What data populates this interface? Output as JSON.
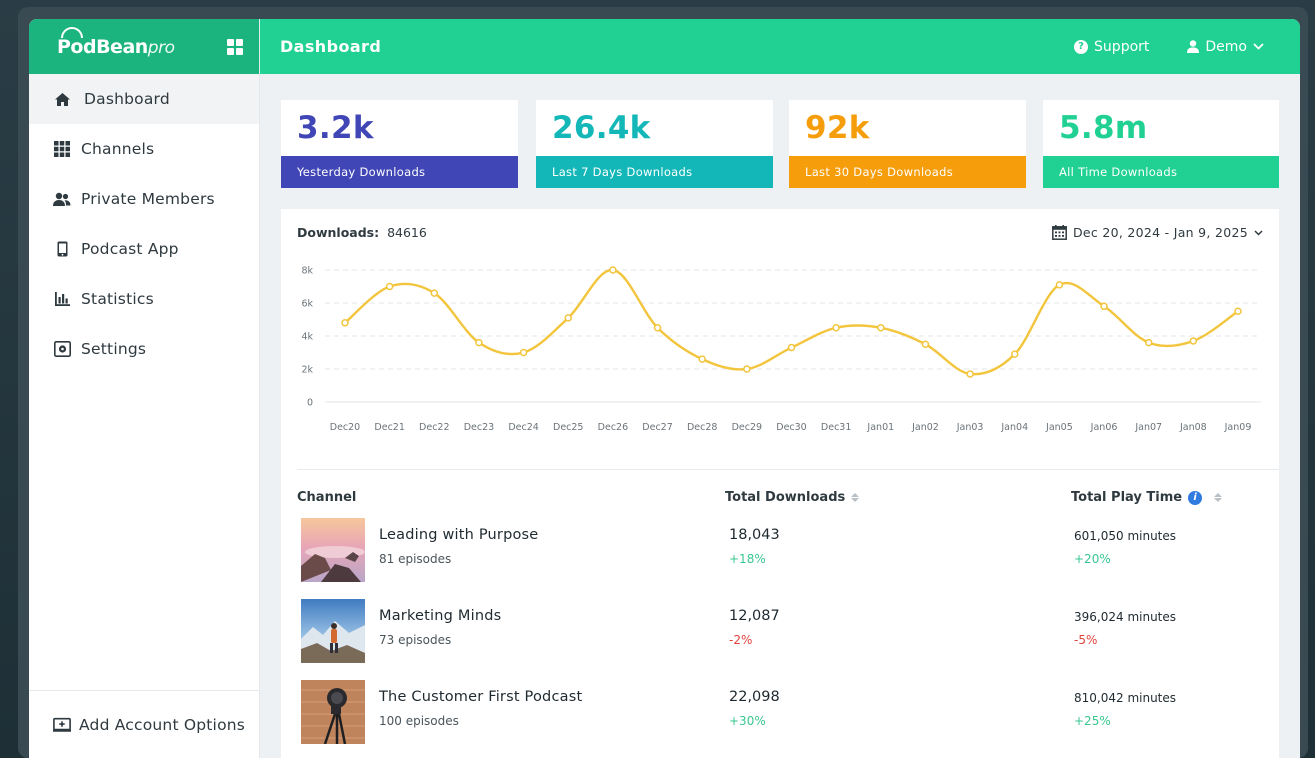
{
  "brand": {
    "logo_main": "PodBean",
    "logo_sub": "pro"
  },
  "topbar": {
    "title": "Dashboard",
    "support_label": "Support",
    "user_label": "Demo"
  },
  "sidebar": {
    "items": [
      {
        "label": "Dashboard",
        "icon": "home-icon",
        "active": true
      },
      {
        "label": "Channels",
        "icon": "grid-icon",
        "active": false
      },
      {
        "label": "Private Members",
        "icon": "users-icon",
        "active": false
      },
      {
        "label": "Podcast App",
        "icon": "phone-icon",
        "active": false
      },
      {
        "label": "Statistics",
        "icon": "bar-chart-icon",
        "active": false
      },
      {
        "label": "Settings",
        "icon": "gear-icon",
        "active": false
      }
    ],
    "bottom_label": "Add Account Options"
  },
  "stats": [
    {
      "value": "3.2k",
      "label": "Yesterday Downloads",
      "color": "#4046b5"
    },
    {
      "value": "26.4k",
      "label": "Last 7 Days Downloads",
      "color": "#14b7b7"
    },
    {
      "value": "92k",
      "label": "Last 30 Days Downloads",
      "color": "#f59d0b"
    },
    {
      "value": "5.8m",
      "label": "All Time Downloads",
      "color": "#21d193"
    }
  ],
  "chart_header": {
    "label": "Downloads",
    "total": "84616",
    "date_range": "Dec 20,  2024 - Jan 9,  2025"
  },
  "chart_data": {
    "type": "line",
    "title": "Downloads",
    "categories": [
      "Dec20",
      "Dec21",
      "Dec22",
      "Dec23",
      "Dec24",
      "Dec25",
      "Dec26",
      "Dec27",
      "Dec28",
      "Dec29",
      "Dec30",
      "Dec31",
      "Jan01",
      "Jan02",
      "Jan03",
      "Jan04",
      "Jan05",
      "Jan06",
      "Jan07",
      "Jan08",
      "Jan09"
    ],
    "values": [
      4800,
      7000,
      6600,
      3600,
      3000,
      5100,
      8000,
      4500,
      2600,
      2000,
      3300,
      4500,
      4500,
      3500,
      1700,
      2900,
      7100,
      5800,
      3600,
      3700,
      5500
    ],
    "yticks": [
      "0",
      "2k",
      "4k",
      "6k",
      "8k"
    ],
    "ylim": [
      0,
      8000
    ],
    "line_color": "#f2c53d",
    "grid": true
  },
  "table": {
    "headers": {
      "channel": "Channel",
      "downloads": "Total Downloads",
      "playtime": "Total Play Time"
    },
    "rows": [
      {
        "title": "Leading with Purpose",
        "episodes": "81 episodes",
        "downloads": "18,043",
        "downloads_change": "+18%",
        "playtime": "601,050 minutes",
        "playtime_change": "+20%"
      },
      {
        "title": "Marketing Minds",
        "episodes": "73 episodes",
        "downloads": "12,087",
        "downloads_change": "-2%",
        "playtime": "396,024 minutes",
        "playtime_change": "-5%"
      },
      {
        "title": "The Customer First Podcast",
        "episodes": "100 episodes",
        "downloads": "22,098",
        "downloads_change": "+30%",
        "playtime": "810,042 minutes",
        "playtime_change": "+25%"
      }
    ]
  }
}
